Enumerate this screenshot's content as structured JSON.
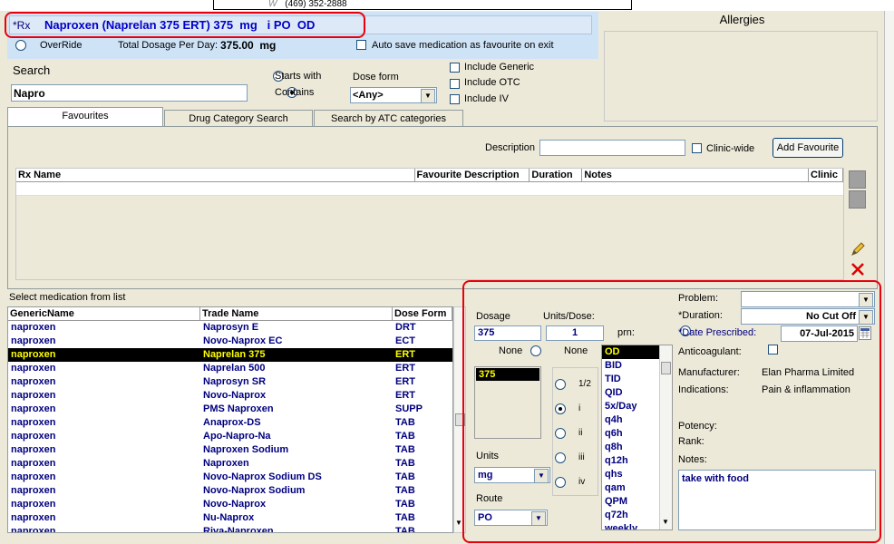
{
  "top": {
    "w_label": "W",
    "phone": "(469) 352-2888"
  },
  "allergies": {
    "title": "Allergies"
  },
  "rx": {
    "prefix": "*Rx",
    "text": "Naproxen (Naprelan 375 ERT) 375  mg   i PO  OD"
  },
  "override": {
    "label": "OverRide",
    "total_label": "Total Dosage Per Day:",
    "total_value": "375.00  mg",
    "autosave_label": "Auto save medication as favourite on exit"
  },
  "search": {
    "label": "Search",
    "value": "Napro",
    "starts_with": "Starts with",
    "contains": "Contains",
    "dose_form_label": "Dose form",
    "dose_form_value": "<Any>",
    "include_generic": "Include Generic",
    "include_otc": "Include OTC",
    "include_iv": "Include IV"
  },
  "tabs": [
    "Favourites",
    "Drug Category Search",
    "Search by ATC categories"
  ],
  "favourites": {
    "description_label": "Description",
    "clinic_wide_label": "Clinic-wide",
    "add_button": "Add Favourite",
    "columns": [
      "Rx Name",
      "Favourite Description",
      "Duration",
      "Notes",
      "Clinic"
    ]
  },
  "medlist": {
    "title": "Select medication from list",
    "columns": [
      "GenericName",
      "Trade Name",
      "Dose Form"
    ],
    "rows": [
      [
        "naproxen",
        "Naprosyn E",
        "DRT"
      ],
      [
        "naproxen",
        "Novo-Naprox EC",
        "ECT"
      ],
      [
        "naproxen",
        "Naprelan 375",
        "ERT"
      ],
      [
        "naproxen",
        "Naprelan 500",
        "ERT"
      ],
      [
        "naproxen",
        "Naprosyn SR",
        "ERT"
      ],
      [
        "naproxen",
        "Novo-Naprox",
        "ERT"
      ],
      [
        "naproxen",
        "PMS Naproxen",
        "SUPP"
      ],
      [
        "naproxen",
        "Anaprox-DS",
        "TAB"
      ],
      [
        "naproxen",
        "Apo-Napro-Na",
        "TAB"
      ],
      [
        "naproxen",
        "Naproxen Sodium",
        "TAB"
      ],
      [
        "naproxen",
        "Naproxen",
        "TAB"
      ],
      [
        "naproxen",
        "Novo-Naprox Sodium DS",
        "TAB"
      ],
      [
        "naproxen",
        "Novo-Naprox Sodium",
        "TAB"
      ],
      [
        "naproxen",
        "Novo-Naprox",
        "TAB"
      ],
      [
        "naproxen",
        "Nu-Naprox",
        "TAB"
      ],
      [
        "naproxen",
        "Riva-Naproxen",
        "TAB"
      ]
    ],
    "selected_index": 2
  },
  "dosage": {
    "dosage_label": "Dosage",
    "dosage_value": "375",
    "units_dose_label": "Units/Dose:",
    "units_dose_value": "1",
    "prn_label": "prn:",
    "none1": "None",
    "none2": "None",
    "list_value": "375",
    "fractions": [
      "1/2",
      "i",
      "ii",
      "iii",
      "iv"
    ],
    "units_label": "Units",
    "units_value": "mg",
    "route_label": "Route",
    "route_value": "PO",
    "frequencies": [
      "OD",
      "BID",
      "TID",
      "QID",
      "5x/Day",
      "q4h",
      "q6h",
      "q8h",
      "q12h",
      "qhs",
      "qam",
      "QPM",
      "q72h",
      "weekly"
    ]
  },
  "details": {
    "problem_label": "Problem:",
    "duration_label": "*Duration:",
    "duration_value": "No Cut Off",
    "date_label": "*Date Prescribed:",
    "date_value": "07-Jul-2015",
    "anticoag_label": "Anticoagulant:",
    "manufacturer_label": "Manufacturer:",
    "manufacturer_value": "Elan Pharma Limited",
    "indications_label": "Indications:",
    "indications_value": "Pain & inflammation",
    "potency_label": "Potency:",
    "rank_label": "Rank:",
    "notes_label": "Notes:",
    "notes_value": "take with food"
  }
}
